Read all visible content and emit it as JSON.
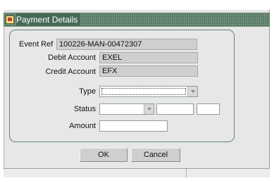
{
  "window": {
    "title": "Payment Details"
  },
  "form": {
    "event_ref": {
      "label": "Event Ref",
      "value": "100226-MAN-00472307"
    },
    "debit_account": {
      "label": "Debit Account",
      "value": "EXEL"
    },
    "credit_account": {
      "label": "Credit Account",
      "value": "EFX"
    },
    "type": {
      "label": "Type",
      "value": ""
    },
    "status": {
      "label": "Status",
      "value": "",
      "extra1": "",
      "extra2": ""
    },
    "amount": {
      "label": "Amount",
      "value": ""
    }
  },
  "buttons": {
    "ok_label": "OK",
    "cancel_label": "Cancel"
  },
  "colors": {
    "titlebar": "#476a56",
    "panel_border": "#5f8579",
    "background": "#e7e7e7"
  }
}
